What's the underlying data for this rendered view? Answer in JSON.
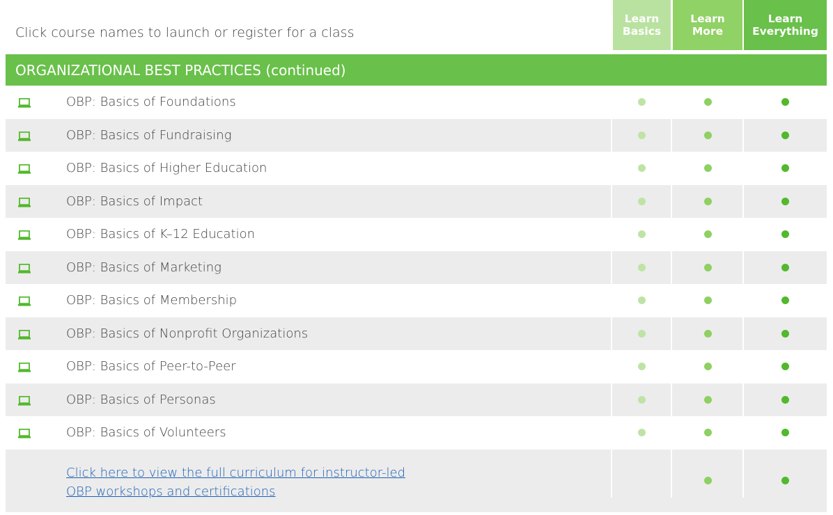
{
  "intro": "Click course names to launch or register for a class",
  "columns": [
    {
      "line1": "Learn",
      "line2": "Basics"
    },
    {
      "line1": "Learn",
      "line2": "More"
    },
    {
      "line1": "Learn",
      "line2": "Everything"
    }
  ],
  "section_title": "ORGANIZATIONAL BEST PRACTICES (continued)",
  "courses": [
    {
      "name": "OBP: Basics of Foundations",
      "icon": "laptop-icon",
      "basics": true,
      "more": true,
      "everything": true
    },
    {
      "name": "OBP: Basics of Fundraising",
      "icon": "laptop-icon",
      "basics": true,
      "more": true,
      "everything": true
    },
    {
      "name": "OBP: Basics of Higher Education",
      "icon": "laptop-icon",
      "basics": true,
      "more": true,
      "everything": true
    },
    {
      "name": "OBP: Basics of Impact",
      "icon": "laptop-icon",
      "basics": true,
      "more": true,
      "everything": true
    },
    {
      "name": "OBP: Basics of K–12 Education",
      "icon": "laptop-icon",
      "basics": true,
      "more": true,
      "everything": true
    },
    {
      "name": "OBP: Basics of Marketing",
      "icon": "laptop-icon",
      "basics": true,
      "more": true,
      "everything": true
    },
    {
      "name": "OBP: Basics of Membership",
      "icon": "laptop-icon",
      "basics": true,
      "more": true,
      "everything": true
    },
    {
      "name": "OBP: Basics of Nonprofit Organizations",
      "icon": "laptop-icon",
      "basics": true,
      "more": true,
      "everything": true
    },
    {
      "name": "OBP: Basics of Peer-to-Peer",
      "icon": "laptop-icon",
      "basics": true,
      "more": true,
      "everything": true
    },
    {
      "name": "OBP: Basics of Personas",
      "icon": "laptop-icon",
      "basics": true,
      "more": true,
      "everything": true
    },
    {
      "name": "OBP: Basics of Volunteers",
      "icon": "laptop-icon",
      "basics": true,
      "more": true,
      "everything": true
    }
  ],
  "footer_link": {
    "line1": "Click here to view the full curriculum for instructor-led",
    "line2": "OBP workshops and certifications",
    "basics": false,
    "more": true,
    "everything": true
  },
  "colors": {
    "basics": "#bfe3a6",
    "more": "#8ed062",
    "everything": "#52b82c",
    "section": "#69c04a",
    "link": "#1a5fb4"
  }
}
